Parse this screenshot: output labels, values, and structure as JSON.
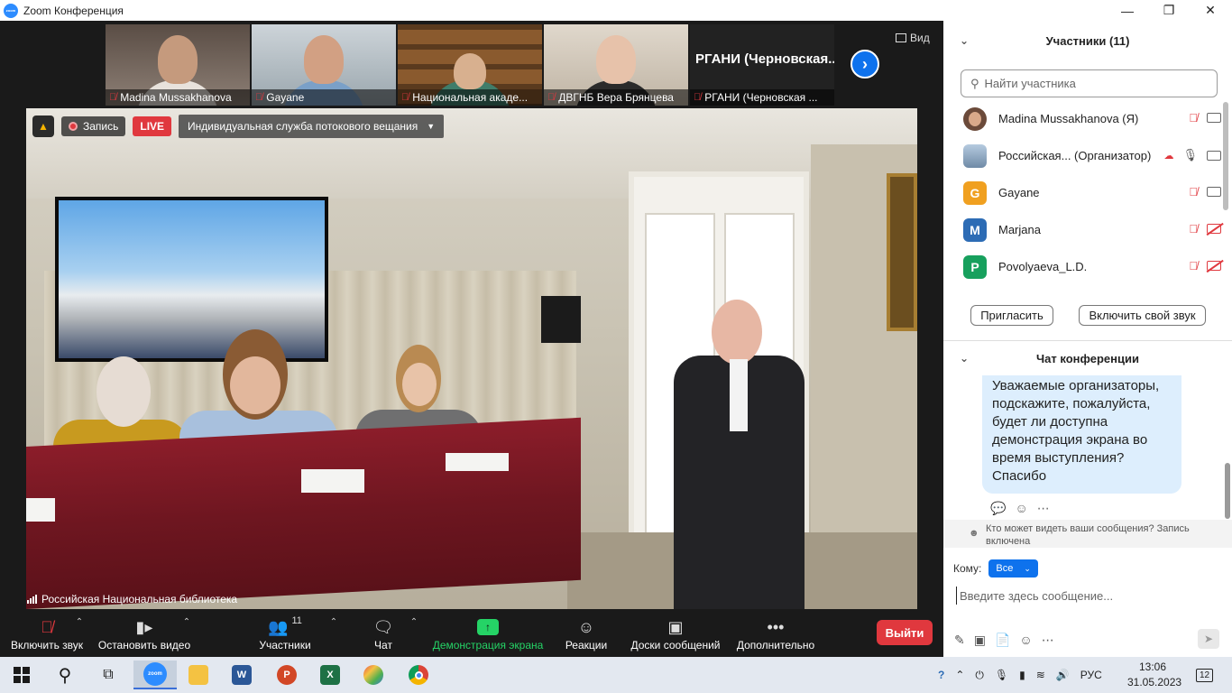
{
  "window": {
    "title": "Zoom Конференция",
    "logo_text": "zoom"
  },
  "thumbnails": [
    {
      "name": "Madina Mussakhanova",
      "muted": true,
      "bg": "#7b6c63",
      "face": "#c59a7d",
      "body": "#e8e2dc"
    },
    {
      "name": "Gayane",
      "muted": true,
      "bg": "#b9c3c9",
      "face": "#d2a083",
      "body": "#7aa0c8"
    },
    {
      "name": "Национальная акаде...",
      "muted": true,
      "bg": "#6e4a2a",
      "face": "#d8b08f",
      "body": "#3f7d6a"
    },
    {
      "name": "ДВГНБ Вера Брянцева",
      "muted": true,
      "bg": "#d8d0c4",
      "face": "#e7c2aa",
      "body": "#2b2b2b"
    },
    {
      "name": "РГАНИ (Черновская ...",
      "muted": true,
      "display_name": "РГАНИ  (Черновская..."
    }
  ],
  "view_label": "Вид",
  "recording": {
    "record_label": "Запись",
    "live_label": "LIVE",
    "stream_label": "Индивидуальная служба потокового вещания"
  },
  "main_video_label": "Российская Национальная библиотека",
  "toolbar": {
    "audio": "Включить звук",
    "video": "Остановить видео",
    "participants": "Участники",
    "participants_count": "11",
    "chat": "Чат",
    "share": "Демонстрация экрана",
    "reactions": "Реакции",
    "whiteboards": "Доски сообщений",
    "more": "Дополнительно",
    "leave": "Выйти"
  },
  "participants_panel": {
    "title": "Участники (11)",
    "search_placeholder": "Найти участника",
    "items": [
      {
        "name": "Madina Mussakhanova (Я)",
        "avatar": "",
        "avatar_color": "#6b4a3a",
        "mic": "off",
        "cam": "on"
      },
      {
        "name": "Российская... (Организатор)",
        "avatar": "",
        "avatar_color": "#8fa9c6",
        "mic": "on",
        "cam": "on",
        "cloud": true
      },
      {
        "name": "Gayane",
        "avatar": "G",
        "avatar_color": "#f0a020",
        "mic": "off",
        "cam": "on"
      },
      {
        "name": "Marjana",
        "avatar": "M",
        "avatar_color": "#2d6cb5",
        "mic": "off",
        "cam": "off"
      },
      {
        "name": "Povolyaeva_L.D.",
        "avatar": "P",
        "avatar_color": "#17a05d",
        "mic": "off",
        "cam": "off"
      }
    ],
    "invite_label": "Пригласить",
    "unmute_label": "Включить свой звук"
  },
  "chat_panel": {
    "title": "Чат конференции",
    "message": "Уважаемые организаторы, подскажите, пожалуйста, будет ли доступна демонстрация экрана во время выступления? Спасибо",
    "message_lines": [
      "Уважаемые организаторы,",
      "подскажите, пожалуйста,",
      "будет ли доступна",
      "демонстрация экрана во",
      "время выступления?",
      "Спасибо"
    ],
    "notice": "Кто может видеть ваши сообщения? Запись включена",
    "notice_line1": "Кто может видеть ваши сообщения? Запись",
    "notice_line2": "включена",
    "to_label": "Кому:",
    "to_value": "Все",
    "input_placeholder": "Введите здесь сообщение..."
  },
  "taskbar": {
    "language": "РУС",
    "time": "13:06",
    "date": "31.05.2023",
    "notifications": "12"
  },
  "colors": {
    "zoom_blue": "#0e72ed",
    "danger_red": "#e0383e",
    "share_green": "#25d366"
  }
}
